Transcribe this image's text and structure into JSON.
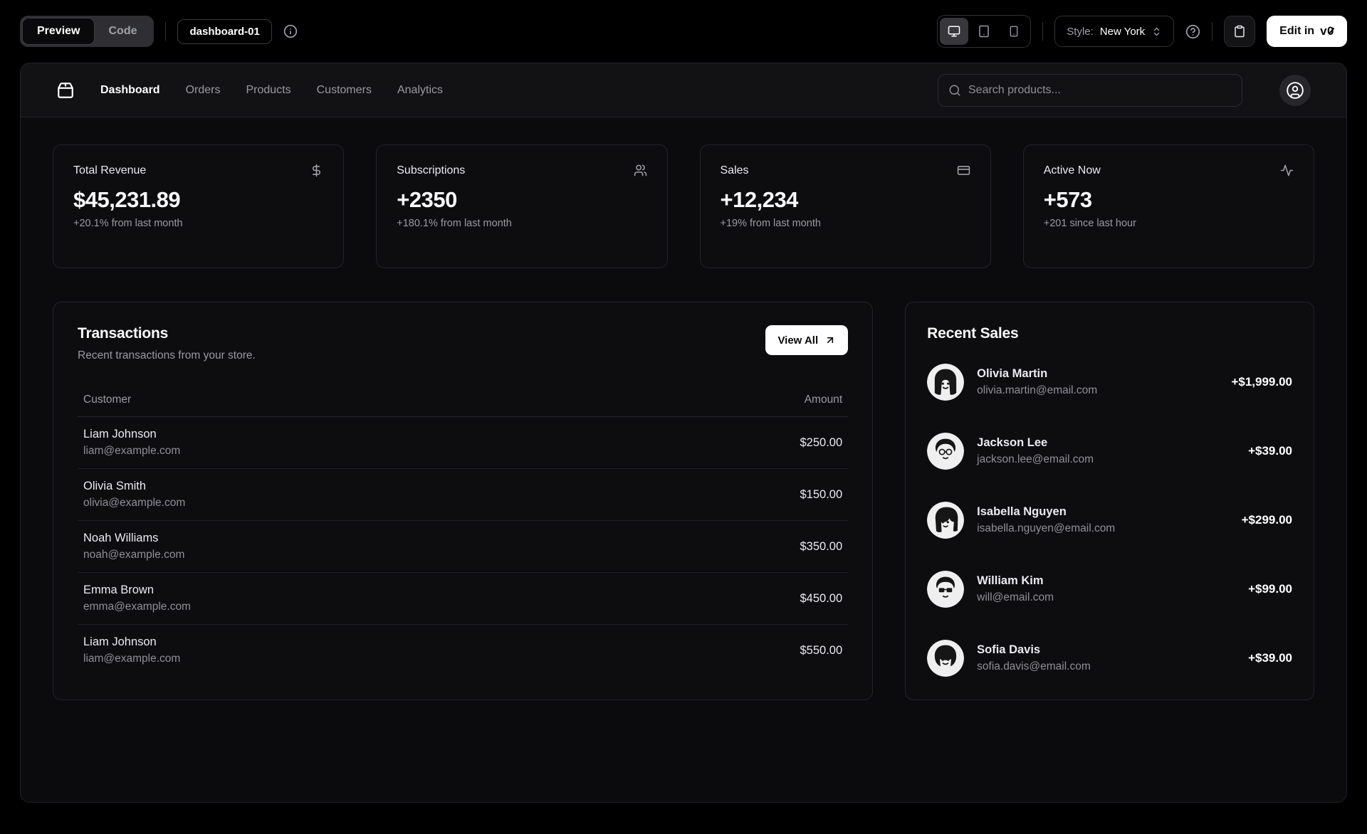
{
  "toolbar": {
    "tabs": [
      {
        "label": "Preview",
        "active": true
      },
      {
        "label": "Code",
        "active": false
      }
    ],
    "block_name": "dashboard-01",
    "info_icon": "info-icon",
    "device_icons": [
      "monitor-icon",
      "tablet-icon",
      "smartphone-icon"
    ],
    "style_label": "Style:",
    "style_value": "New York",
    "help_icon": "help-circle-icon",
    "copy_icon": "clipboard-icon",
    "edit_button_label": "Edit in",
    "edit_button_brand": "v0"
  },
  "nav": {
    "logo_icon": "package-icon",
    "links": [
      "Dashboard",
      "Orders",
      "Products",
      "Customers",
      "Analytics"
    ],
    "active_link": "Dashboard",
    "search_placeholder": "Search products...",
    "account_icon": "user-circle-icon"
  },
  "stats": [
    {
      "label": "Total Revenue",
      "icon": "dollar-sign-icon",
      "value": "$45,231.89",
      "change": "+20.1% from last month"
    },
    {
      "label": "Subscriptions",
      "icon": "users-icon",
      "value": "+2350",
      "change": "+180.1% from last month"
    },
    {
      "label": "Sales",
      "icon": "credit-card-icon",
      "value": "+12,234",
      "change": "+19% from last month"
    },
    {
      "label": "Active Now",
      "icon": "activity-icon",
      "value": "+573",
      "change": "+201 since last hour"
    }
  ],
  "transactions": {
    "title": "Transactions",
    "subtitle": "Recent transactions from your store.",
    "view_all_label": "View All",
    "view_all_icon": "arrow-up-right-icon",
    "columns": [
      "Customer",
      "Amount"
    ],
    "rows": [
      {
        "name": "Liam Johnson",
        "email": "liam@example.com",
        "amount": "$250.00"
      },
      {
        "name": "Olivia Smith",
        "email": "olivia@example.com",
        "amount": "$150.00"
      },
      {
        "name": "Noah Williams",
        "email": "noah@example.com",
        "amount": "$350.00"
      },
      {
        "name": "Emma Brown",
        "email": "emma@example.com",
        "amount": "$450.00"
      },
      {
        "name": "Liam Johnson",
        "email": "liam@example.com",
        "amount": "$550.00"
      }
    ]
  },
  "recent_sales": {
    "title": "Recent Sales",
    "items": [
      {
        "name": "Olivia Martin",
        "email": "olivia.martin@email.com",
        "amount": "+$1,999.00"
      },
      {
        "name": "Jackson Lee",
        "email": "jackson.lee@email.com",
        "amount": "+$39.00"
      },
      {
        "name": "Isabella Nguyen",
        "email": "isabella.nguyen@email.com",
        "amount": "+$299.00"
      },
      {
        "name": "William Kim",
        "email": "will@email.com",
        "amount": "+$99.00"
      },
      {
        "name": "Sofia Davis",
        "email": "sofia.davis@email.com",
        "amount": "+$39.00"
      }
    ]
  },
  "colors": {
    "page_background": "#000000",
    "panel_background": "#0b0b0d",
    "card_background": "#0d0d10",
    "border": "#232329",
    "text_primary": "#fafafa",
    "text_muted": "#9a9aa2",
    "button_primary": "#ffffff"
  }
}
